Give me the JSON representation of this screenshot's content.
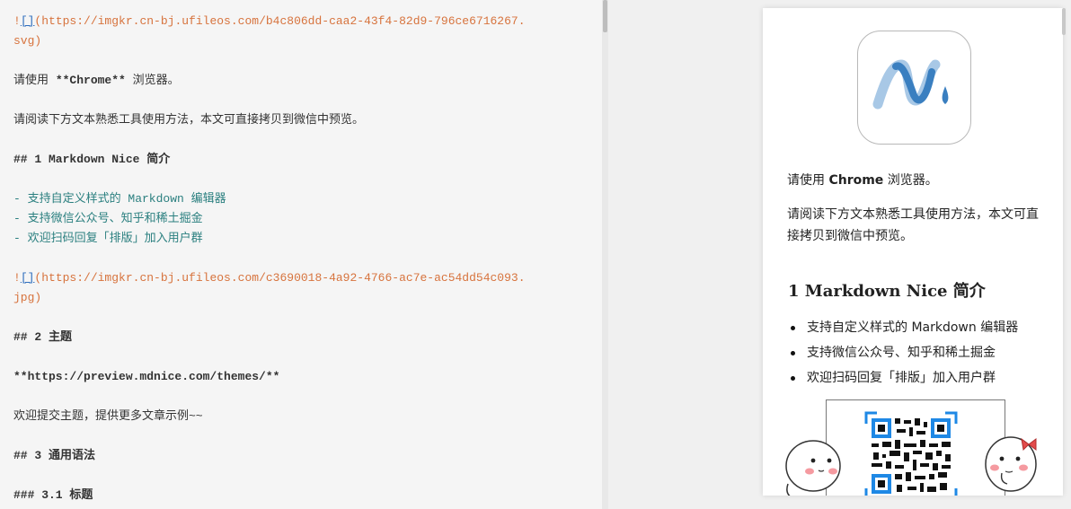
{
  "editor": {
    "lines": {
      "img1_url": "(https://imgkr.cn-bj.ufileos.com/b4c806dd-caa2-43f4-82d9-796ce6716267.",
      "img1_tail": "svg)",
      "l_chrome_pre": "请使用 ",
      "l_chrome_bold": "**Chrome**",
      "l_chrome_post": " 浏览器。",
      "l_read": "请阅读下方文本熟悉工具使用方法，本文可直接拷贝到微信中预览。",
      "h1": "## 1 Markdown Nice 简介",
      "li1": "- 支持自定义样式的 Markdown 编辑器",
      "li2": "- 支持微信公众号、知乎和稀土掘金",
      "li3": "- 欢迎扫码回复「排版」加入用户群",
      "img2_url": "(https://imgkr.cn-bj.ufileos.com/c3690018-4a92-4766-ac7e-ac54dd54c093.",
      "img2_tail": "jpg)",
      "h2": "## 2 主题",
      "themes": "**https://preview.mdnice.com/themes/**",
      "welcome": "欢迎提交主题，提供更多文章示例~~",
      "h3": "## 3 通用语法",
      "h31": "### 3.1 标题",
      "img_prefix": "!",
      "img_brackets": "[]"
    }
  },
  "preview": {
    "p1_pre": "请使用 ",
    "p1_bold": "Chrome",
    "p1_post": " 浏览器。",
    "p2": "请阅读下方文本熟悉工具使用方法，本文可直接拷贝到微信中预览。",
    "h2": "1 Markdown Nice 简介",
    "list": [
      "支持自定义样式的 Markdown 编辑器",
      "支持微信公众号、知乎和稀土掘金",
      "欢迎扫码回复「排版」加入用户群"
    ]
  },
  "colors": {
    "logo_dark": "#3a7fc0",
    "logo_light": "#a8c8e6",
    "qr_frame": "#1e88e5"
  }
}
